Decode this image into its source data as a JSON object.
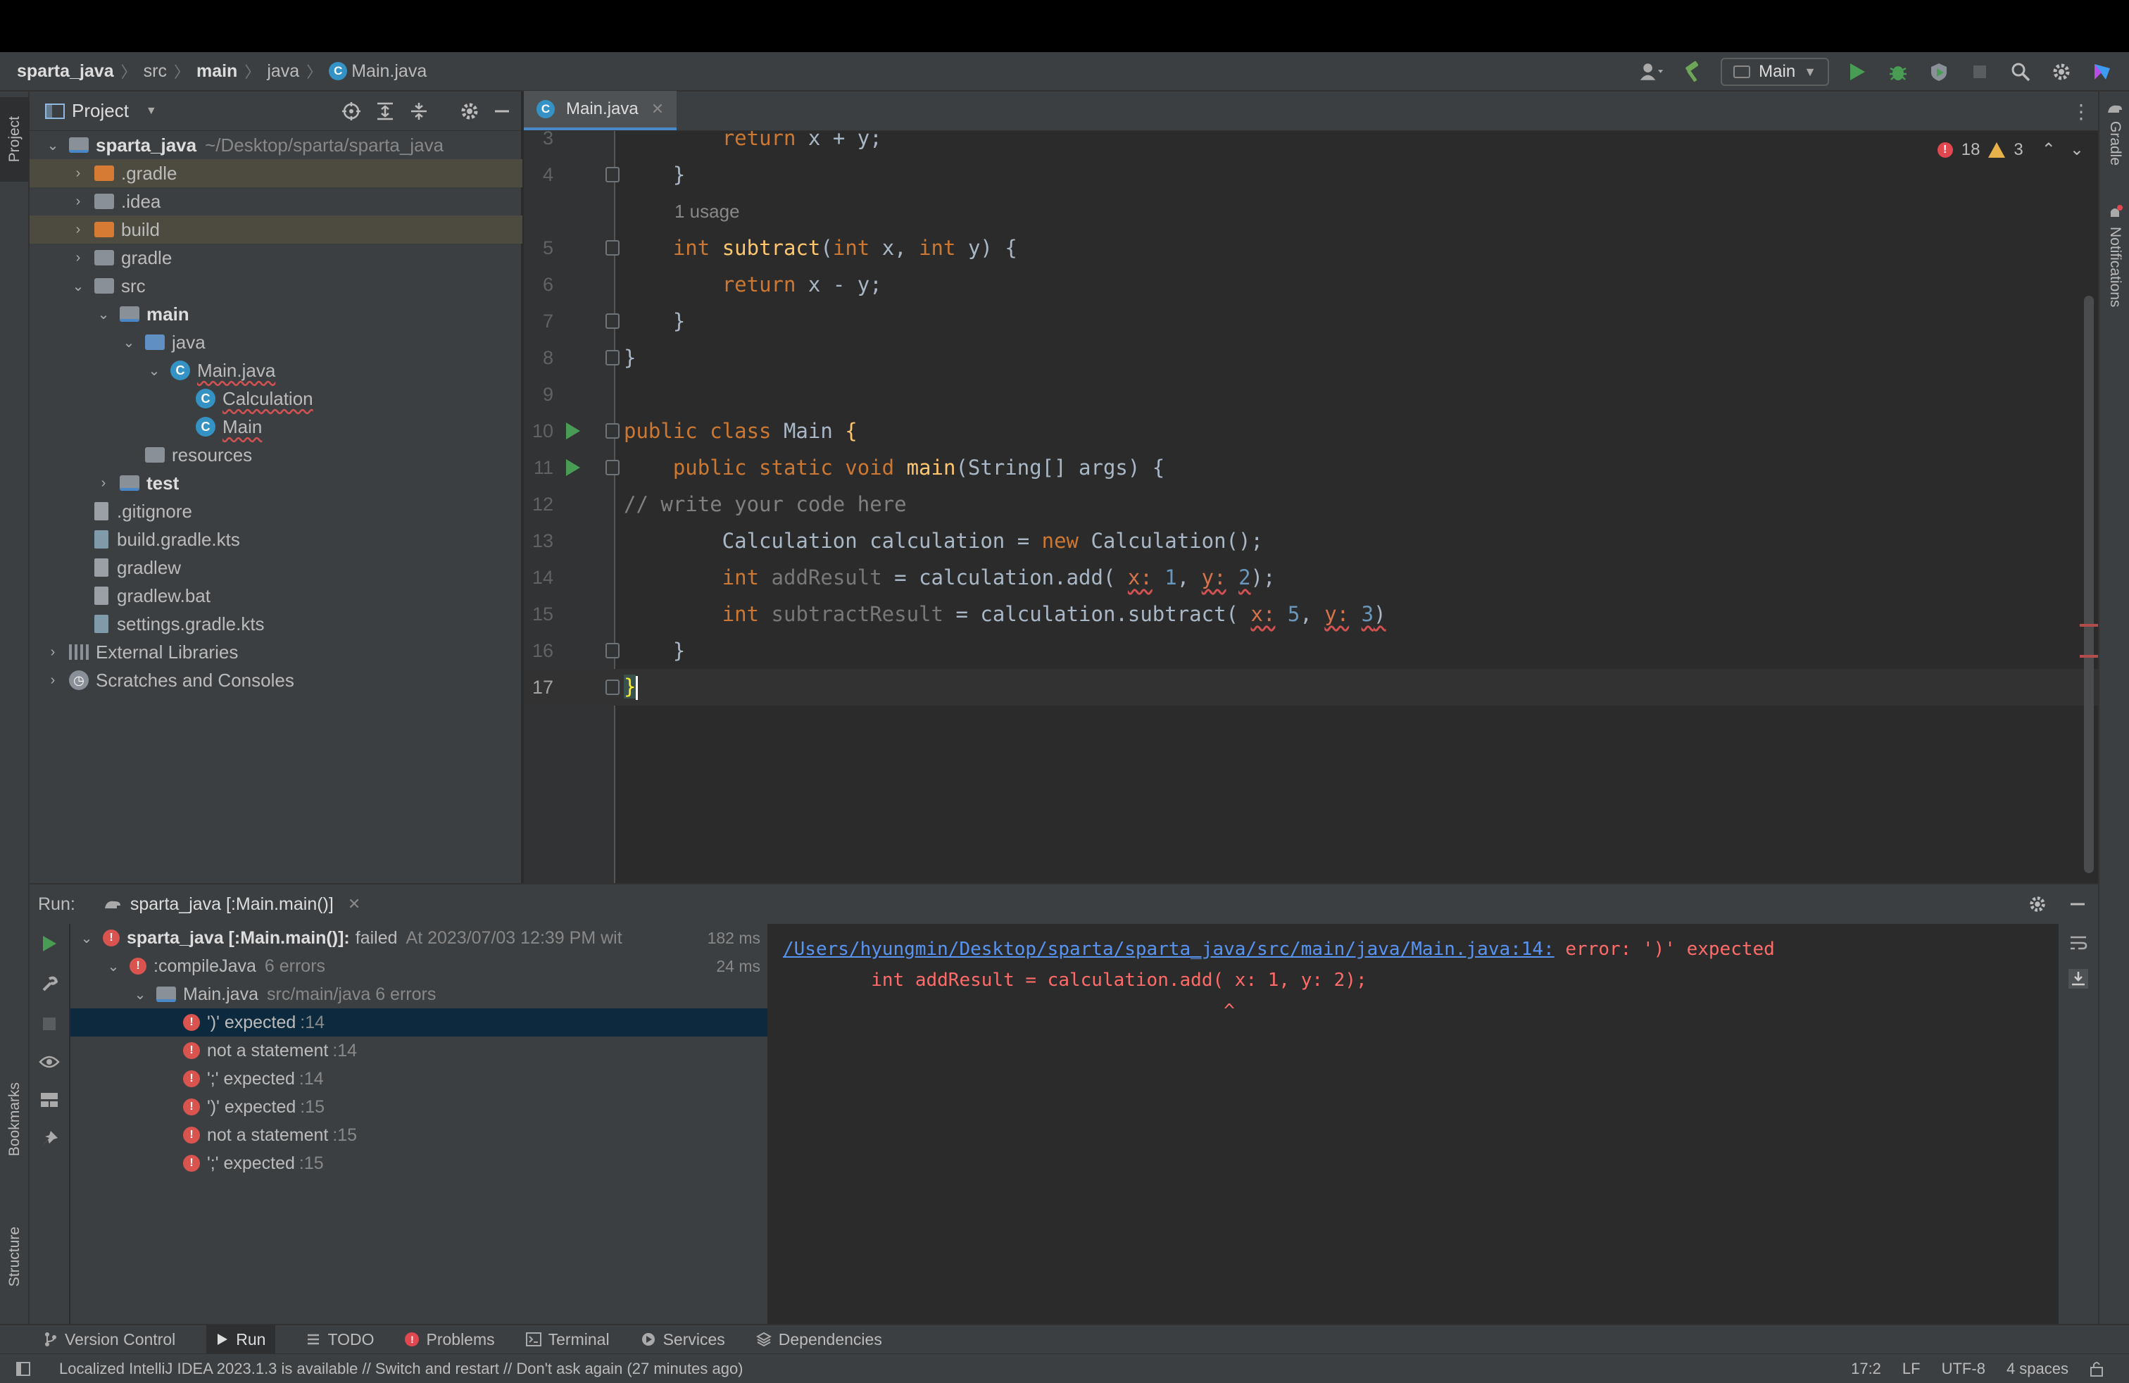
{
  "breadcrumbs": [
    "sparta_java",
    "src",
    "main",
    "java",
    "Main.java"
  ],
  "toolbar": {
    "run_config": "Main"
  },
  "project_panel": {
    "title": "Project",
    "tree": [
      {
        "label": "sparta_java",
        "extra": "~/Desktop/sparta/sparta_java",
        "depth": 0,
        "icon": "module-folder",
        "expanded": true,
        "bold": true
      },
      {
        "label": ".gradle",
        "depth": 1,
        "icon": "folder-orange",
        "expanded": false,
        "highlight": true
      },
      {
        "label": ".idea",
        "depth": 1,
        "icon": "folder-grey",
        "expanded": false
      },
      {
        "label": "build",
        "depth": 1,
        "icon": "folder-orange",
        "expanded": false,
        "highlight": true
      },
      {
        "label": "gradle",
        "depth": 1,
        "icon": "folder-grey",
        "expanded": false
      },
      {
        "label": "src",
        "depth": 1,
        "icon": "folder-grey",
        "expanded": true
      },
      {
        "label": "main",
        "depth": 2,
        "icon": "module-folder",
        "expanded": true,
        "bold": true
      },
      {
        "label": "java",
        "depth": 3,
        "icon": "folder-blue",
        "expanded": true
      },
      {
        "label": "Main.java",
        "depth": 4,
        "icon": "java-class",
        "expanded": true,
        "error": true
      },
      {
        "label": "Calculation",
        "depth": 5,
        "icon": "java-class",
        "error": true
      },
      {
        "label": "Main",
        "depth": 5,
        "icon": "java-class",
        "error": true
      },
      {
        "label": "resources",
        "depth": 3,
        "icon": "folder-grey"
      },
      {
        "label": "test",
        "depth": 2,
        "icon": "module-folder",
        "expanded": false,
        "bold": true
      },
      {
        "label": ".gitignore",
        "depth": 1,
        "icon": "file"
      },
      {
        "label": "build.gradle.kts",
        "depth": 1,
        "icon": "gradle-file"
      },
      {
        "label": "gradlew",
        "depth": 1,
        "icon": "file"
      },
      {
        "label": "gradlew.bat",
        "depth": 1,
        "icon": "file"
      },
      {
        "label": "settings.gradle.kts",
        "depth": 1,
        "icon": "gradle-file"
      },
      {
        "label": "External Libraries",
        "depth": 0,
        "icon": "library",
        "expanded": false
      },
      {
        "label": "Scratches and Consoles",
        "depth": 0,
        "icon": "scratches",
        "expanded": false
      }
    ]
  },
  "editor": {
    "tab": "Main.java",
    "inspections": {
      "errors": "18",
      "warnings": "3"
    },
    "usage_hint": "1 usage"
  },
  "right_strip": {
    "gradle": "Gradle",
    "notifications": "Notifications"
  },
  "left_strip": {
    "project": "Project",
    "bookmarks": "Bookmarks",
    "structure": "Structure"
  },
  "run_panel": {
    "label": "Run:",
    "tab": "sparta_java [:Main.main()]",
    "tree": [
      {
        "label": "sparta_java [:Main.main()]:",
        "suffix": "failed",
        "detail": "At 2023/07/03 12:39 PM wit",
        "time": "182 ms",
        "depth": 0
      },
      {
        "label": ":compileJava",
        "detail": "6 errors",
        "time": "24 ms",
        "depth": 1
      },
      {
        "label": "Main.java",
        "detail": "src/main/java 6 errors",
        "depth": 2
      },
      {
        "label": "')' expected",
        "detail": ":14",
        "depth": 3,
        "selected": true
      },
      {
        "label": "not a statement",
        "detail": ":14",
        "depth": 3
      },
      {
        "label": "';' expected",
        "detail": ":14",
        "depth": 3
      },
      {
        "label": "')' expected",
        "detail": ":15",
        "depth": 3
      },
      {
        "label": "not a statement",
        "detail": ":15",
        "depth": 3
      },
      {
        "label": "';' expected",
        "detail": ":15",
        "depth": 3
      }
    ],
    "console": {
      "link": "/Users/hyungmin/Desktop/sparta/sparta_java/src/main/java/Main.java:14:",
      "message": " error: ')' expected",
      "line2": "        int addResult = calculation.add( x: 1, y: 2);",
      "line3": "                                        ^"
    }
  },
  "bottom_tabs": [
    "Version Control",
    "Run",
    "TODO",
    "Problems",
    "Terminal",
    "Services",
    "Dependencies"
  ],
  "status": {
    "message": "Localized IntelliJ IDEA 2023.1.3 is available // Switch and restart // Don't ask again (27 minutes ago)",
    "position": "17:2",
    "line_sep": "LF",
    "encoding": "UTF-8",
    "indent": "4 spaces"
  },
  "colors": {
    "keyword": "#cc7832",
    "function": "#ffc66d",
    "number": "#6897bb",
    "error": "#ff6b68",
    "link": "#5894f2",
    "run_green": "#499c54"
  }
}
